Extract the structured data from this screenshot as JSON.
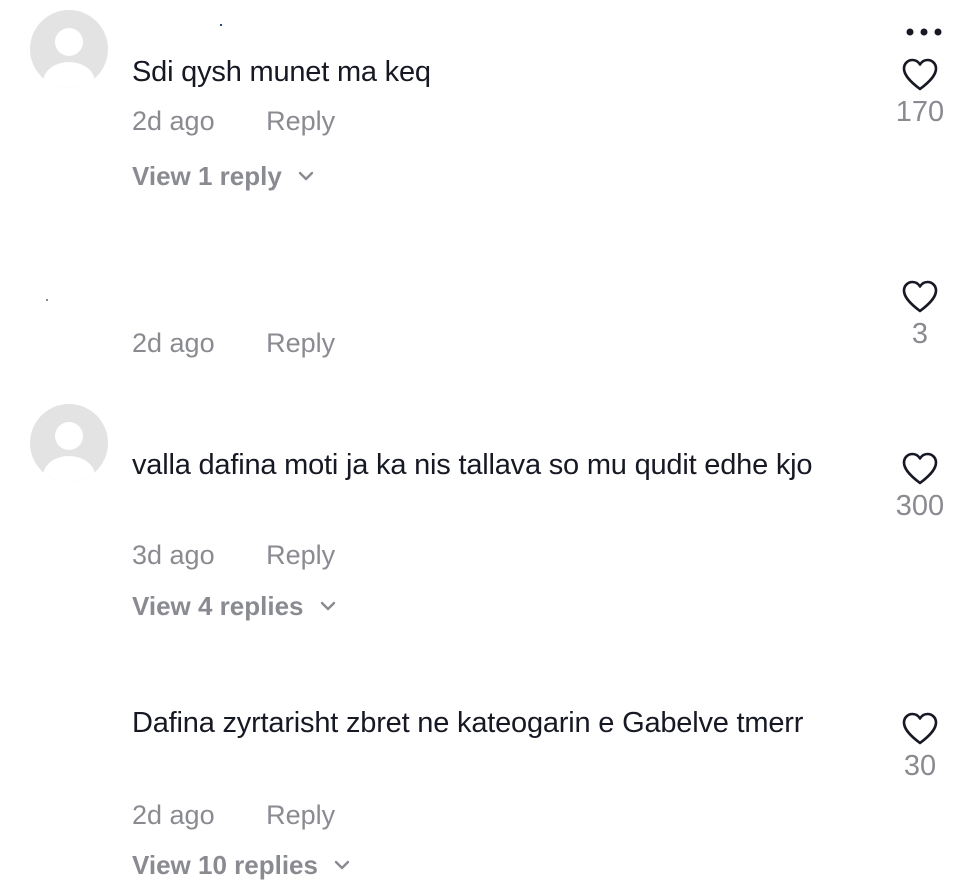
{
  "more_icon": "more-horizontal-icon",
  "heart_icon": "heart-outline-icon",
  "chevron_icon": "chevron-down-icon",
  "colors": {
    "text": "#161823",
    "muted": "#8a8b91",
    "avatar_bg": "#e3e3e4"
  },
  "comments": [
    {
      "text": "Sdi qysh munet ma keq",
      "time": "2d ago",
      "reply_label": "Reply",
      "likes": "170",
      "view_replies": "View 1 reply"
    },
    {
      "text": "",
      "time": "2d ago",
      "reply_label": "Reply",
      "likes": "3"
    },
    {
      "text": "valla dafina moti ja ka nis tallava so mu qudit edhe kjo",
      "time": "3d ago",
      "reply_label": "Reply",
      "likes": "300",
      "view_replies": "View 4 replies"
    },
    {
      "text": "Dafina zyrtarisht zbret ne kateogarin e Gabelve tmerr",
      "time": "2d ago",
      "reply_label": "Reply",
      "likes": "30",
      "view_replies": "View 10 replies"
    }
  ]
}
